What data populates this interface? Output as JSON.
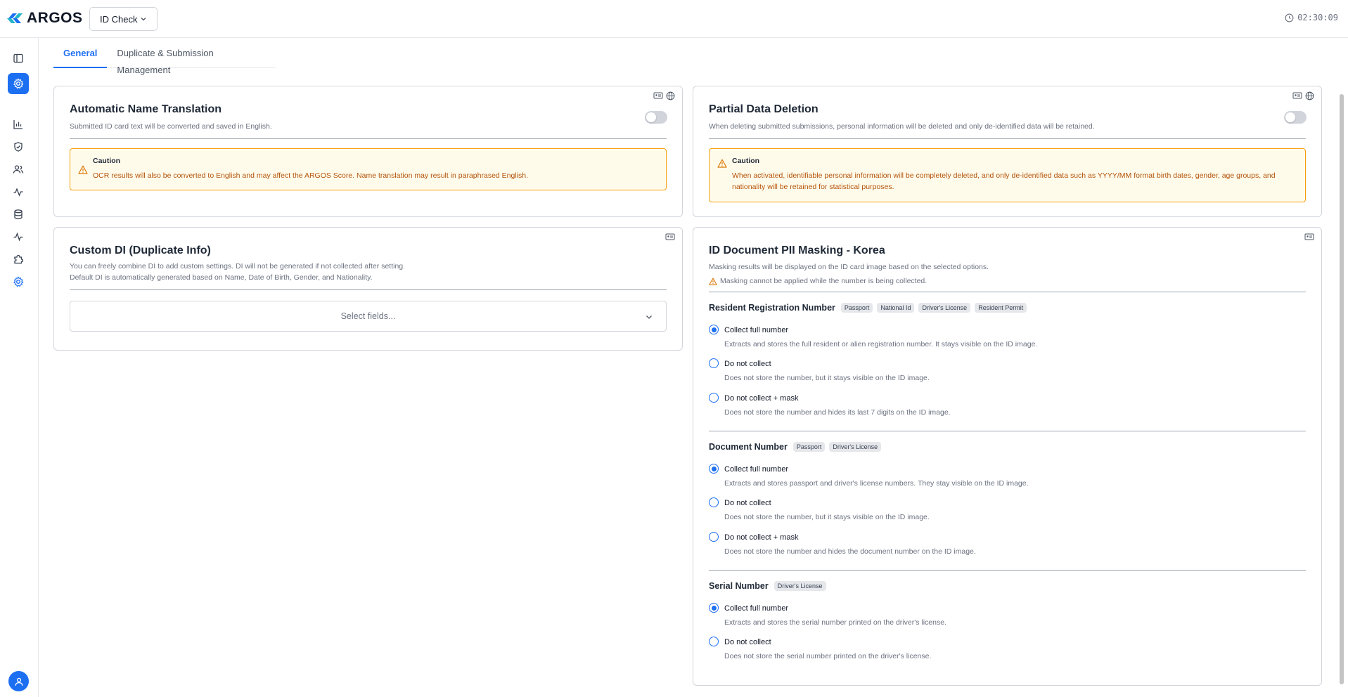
{
  "header": {
    "logo_text": "ARGOS",
    "product_selector": "ID Check",
    "clock": "02:30:09"
  },
  "tabs": [
    {
      "label": "General",
      "active": true
    },
    {
      "label": "Duplicate & Submission Management",
      "active": false
    }
  ],
  "sidebar": {
    "items": [
      "panel-toggle-icon",
      "settings-icon",
      "chart-icon",
      "shield-check-icon",
      "users-icon",
      "activity-icon",
      "database-icon",
      "pulse-icon",
      "puzzle-icon",
      "settings-icon"
    ],
    "active_index": 1
  },
  "translation_card": {
    "title": "Automatic Name Translation",
    "description": "Submitted ID card text will be converted and saved in English.",
    "caution_title": "Caution",
    "caution_text": "OCR results will also be converted to English and may affect the ARGOS Score. Name translation may result in paraphrased English."
  },
  "deletion_card": {
    "title": "Partial Data Deletion",
    "description": "When deleting submitted submissions, personal information will be deleted and only de-identified data will be retained.",
    "caution_title": "Caution",
    "caution_text": "When activated, identifiable personal information will be completely deleted, and only de-identified data such as YYYY/MM format birth dates, gender, age groups, and nationality will be retained for statistical purposes."
  },
  "custom_di_card": {
    "title": "Custom DI (Duplicate Info)",
    "description_1": "You can freely combine DI to add custom settings. DI will not be generated if not collected after setting.",
    "description_2": "Default DI is automatically generated based on Name, Date of Birth, Gender, and Nationality.",
    "select_placeholder": "Select fields..."
  },
  "masking_card": {
    "title": "ID Document PII Masking - Korea",
    "description": "Masking results will be displayed on the ID card image based on the selected options.",
    "warning": "Masking cannot be applied while the number is being collected.",
    "sections": [
      {
        "title": "Resident Registration Number",
        "chips": [
          "Passport",
          "National Id",
          "Driver's License",
          "Resident Permit"
        ],
        "options": [
          {
            "label": "Collect full number",
            "desc": "Extracts and stores the full resident or alien registration number. It stays visible on the ID image.",
            "checked": true
          },
          {
            "label": "Do not collect",
            "desc": "Does not store the number, but it stays visible on the ID image.",
            "checked": false
          },
          {
            "label": "Do not collect + mask",
            "desc": "Does not store the number and hides its last 7 digits on the ID image.",
            "checked": false
          }
        ]
      },
      {
        "title": "Document Number",
        "chips": [
          "Passport",
          "Driver's License"
        ],
        "options": [
          {
            "label": "Collect full number",
            "desc": "Extracts and stores passport and driver's license numbers. They stay visible on the ID image.",
            "checked": true
          },
          {
            "label": "Do not collect",
            "desc": "Does not store the number, but it stays visible on the ID image.",
            "checked": false
          },
          {
            "label": "Do not collect + mask",
            "desc": "Does not store the number and hides the document number on the ID image.",
            "checked": false
          }
        ]
      },
      {
        "title": "Serial Number",
        "chips": [
          "Driver's License"
        ],
        "options": [
          {
            "label": "Collect full number",
            "desc": "Extracts and stores the serial number printed on the driver's license.",
            "checked": true
          },
          {
            "label": "Do not collect",
            "desc": "Does not store the serial number printed on the driver's license.",
            "checked": false
          }
        ]
      }
    ]
  },
  "colors": {
    "accent": "#1d6ff2",
    "caution_border": "#f59e0b",
    "caution_bg": "#fffbeb",
    "caution_text": "#b45309"
  }
}
